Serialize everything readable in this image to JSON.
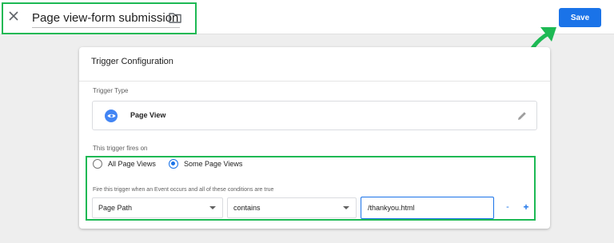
{
  "header": {
    "title": "Page view-form submission",
    "save_label": "Save"
  },
  "trigger": {
    "card_title": "Trigger Configuration",
    "type_label": "Trigger Type",
    "type_name": "Page View",
    "fires_on_label": "This trigger fires on",
    "options": [
      {
        "label": "All Page Views",
        "selected": false
      },
      {
        "label": "Some Page Views",
        "selected": true
      }
    ],
    "condition_label": "Fire this trigger when an Event occurs and all of these conditions are true",
    "condition": {
      "variable": "Page Path",
      "operator": "contains",
      "value": "/thankyou.html",
      "remove_label": "-",
      "add_label": "+"
    }
  },
  "colors": {
    "accent": "#1a73e8",
    "highlight": "#1db954",
    "type_icon": "#4285f4"
  },
  "icons": [
    "close-icon",
    "folder-icon",
    "eye-icon",
    "pencil-icon",
    "chevron-down-icon"
  ]
}
